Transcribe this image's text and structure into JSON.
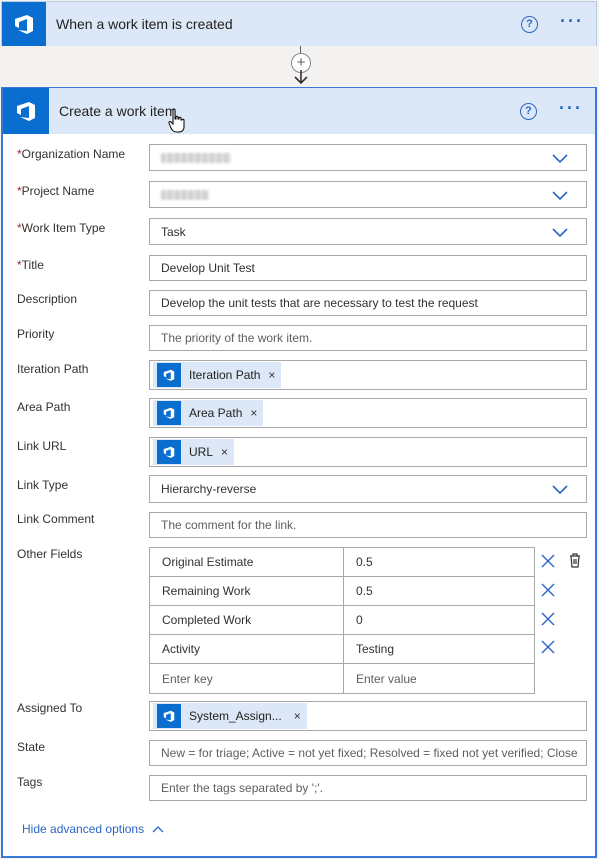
{
  "trigger": {
    "title": "When a work item is created",
    "help": "?"
  },
  "action": {
    "title": "Create a work item",
    "help": "?"
  },
  "fields": {
    "organization": {
      "label": "Organization Name",
      "required": true
    },
    "project": {
      "label": "Project Name",
      "required": true
    },
    "work_item_type": {
      "label": "Work Item Type",
      "required": true,
      "value": "Task"
    },
    "title": {
      "label": "Title",
      "required": true,
      "value": "Develop Unit Test"
    },
    "description": {
      "label": "Description",
      "value": "Develop the unit tests that are necessary to test the request"
    },
    "priority": {
      "label": "Priority",
      "placeholder": "The priority of the work item."
    },
    "iteration_path": {
      "label": "Iteration Path",
      "token": "Iteration Path"
    },
    "area_path": {
      "label": "Area Path",
      "token": "Area Path"
    },
    "link_url": {
      "label": "Link URL",
      "token": "URL"
    },
    "link_type": {
      "label": "Link Type",
      "value": "Hierarchy-reverse"
    },
    "link_comment": {
      "label": "Link Comment",
      "placeholder": "The comment for the link."
    },
    "other_fields": {
      "label": "Other Fields",
      "rows": [
        {
          "key": "Original Estimate",
          "value": "0.5"
        },
        {
          "key": "Remaining Work",
          "value": "0.5"
        },
        {
          "key": "Completed Work",
          "value": "0"
        },
        {
          "key": "Activity",
          "value": "Testing"
        }
      ],
      "key_placeholder": "Enter key",
      "value_placeholder": "Enter value"
    },
    "assigned_to": {
      "label": "Assigned To",
      "token": "System_Assign..."
    },
    "state": {
      "label": "State",
      "placeholder": "New = for triage; Active = not yet fixed; Resolved = fixed not yet verified; Close"
    },
    "tags": {
      "label": "Tags",
      "placeholder": "Enter the tags separated by ';'."
    }
  },
  "hide_advanced": "Hide advanced options",
  "token_close": "×",
  "colors": {
    "header_bg": "#dce8f7",
    "logo_blue": "#0a6ed1",
    "accent": "#2b66c5",
    "required": "#a4262c"
  },
  "icons": [
    "azure-devops-logo",
    "help-icon",
    "more-options-icon",
    "add-step-icon",
    "arrow-down-icon",
    "chevron-down-icon",
    "delete-x-icon",
    "trash-icon",
    "chevron-up-icon",
    "hand-cursor-icon"
  ]
}
